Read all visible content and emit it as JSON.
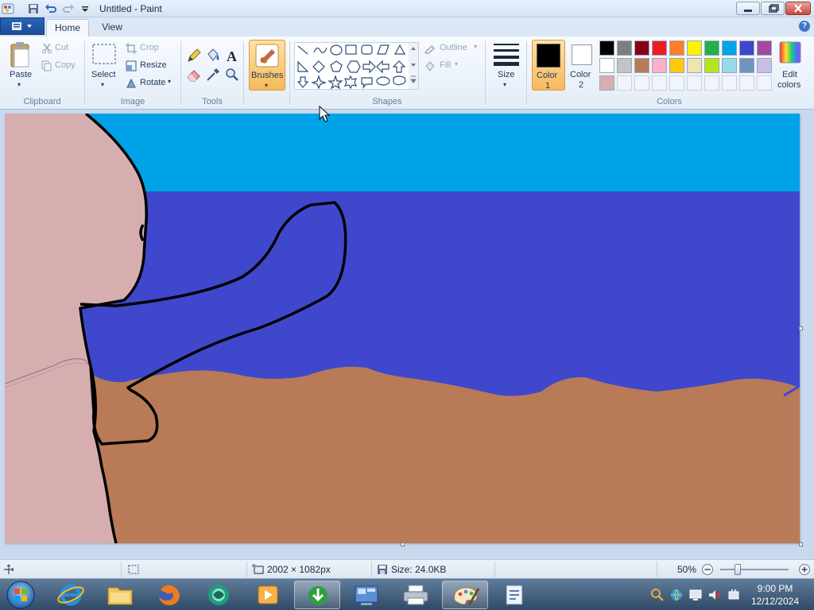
{
  "window": {
    "title": "Untitled - Paint",
    "controls": [
      "minimize",
      "maximize",
      "close"
    ]
  },
  "quick_access": [
    "save-icon",
    "undo-icon",
    "redo-icon",
    "customize-dropdown-icon"
  ],
  "tabs": [
    {
      "label": "Home",
      "active": true
    },
    {
      "label": "View",
      "active": false
    }
  ],
  "ribbon": {
    "clipboard": {
      "paste": "Paste",
      "cut": "Cut",
      "copy": "Copy",
      "group": "Clipboard"
    },
    "image": {
      "select": "Select",
      "crop": "Crop",
      "resize": "Resize",
      "rotate": "Rotate",
      "group": "Image"
    },
    "tools": {
      "group": "Tools",
      "items": [
        "pencil-icon",
        "fill-bucket-icon",
        "text-icon",
        "eraser-icon",
        "color-picker-icon",
        "magnifier-icon"
      ]
    },
    "brushes": {
      "label": "Brushes"
    },
    "shapes": {
      "outline": "Outline",
      "fill": "Fill",
      "group": "Shapes"
    },
    "size": {
      "label": "Size"
    },
    "color1": {
      "label1": "Color",
      "label2": "1",
      "value": "#000000"
    },
    "color2": {
      "label1": "Color",
      "label2": "2",
      "value": "#ffffff"
    },
    "colors": {
      "group": "Colors",
      "row1": [
        "#000000",
        "#7f7f7f",
        "#880015",
        "#ed1c24",
        "#ff7f27",
        "#fff200",
        "#22b14c",
        "#00a2e8",
        "#3f48cc",
        "#a349a4"
      ],
      "row2": [
        "#ffffff",
        "#c3c3c3",
        "#b97a57",
        "#ffaec9",
        "#ffc90e",
        "#efe4b0",
        "#b5e61d",
        "#99d9ea",
        "#7092be",
        "#c8bfe7"
      ],
      "row3": [
        "#d7aeb0",
        "",
        "",
        "",
        "",
        "",
        "",
        "",
        "",
        ""
      ]
    },
    "edit_colors": {
      "label1": "Edit",
      "label2": "colors"
    }
  },
  "canvas_colors": {
    "sky": "#00a2e8",
    "sea": "#3f48cc",
    "sand": "#b97a57",
    "skin": "#d7aeb0",
    "outline": "#000000"
  },
  "status": {
    "canvas_size": "2002 × 1082px",
    "file_size": "Size: 24.0KB",
    "zoom": "50%",
    "zoom_fraction": 0.25
  },
  "taskbar": {
    "apps": [
      "start-orb-icon",
      "internet-explorer-icon",
      "file-explorer-icon",
      "firefox-icon",
      "app-icon",
      "media-player-icon",
      "download-manager-icon",
      "control-panel-icon",
      "printer-icon",
      "paint-icon",
      "document-icon"
    ],
    "time": "9:00 PM",
    "date": "12/12/2024"
  }
}
